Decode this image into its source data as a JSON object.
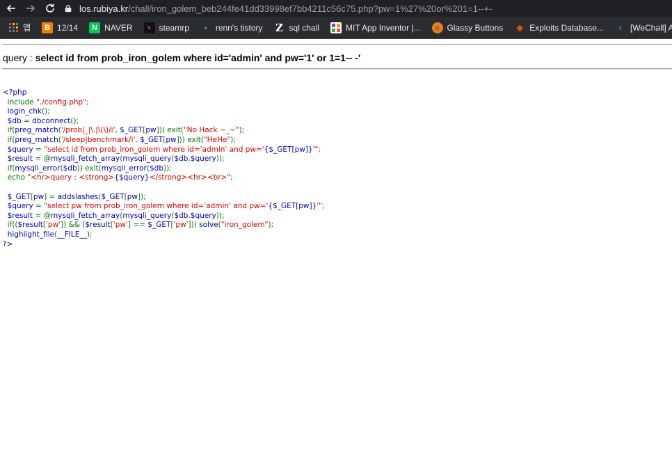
{
  "browser": {
    "url_host": "los.rubiya.kr",
    "url_path": "/chall/iron_golem_beb244fe41dd33998ef7bb4211c56c75.php?pw=1%27%20or%201=1--+-",
    "bookmarks": [
      {
        "label": "앱",
        "icon": "apps-grid-icon"
      },
      {
        "label": "12/14",
        "icon": "blogger-icon",
        "color": "#f57d00"
      },
      {
        "label": "NAVER",
        "icon": "naver-icon",
        "color": "#03c75a"
      },
      {
        "label": "steamrp",
        "icon": "steamrp-icon",
        "color": "#c0392b"
      },
      {
        "label": "renn's tistory",
        "icon": "tistory-icon",
        "color": "#4a90e2"
      },
      {
        "label": "sql chall",
        "icon": "z-icon",
        "color": "#ffffff"
      },
      {
        "label": "MIT App Inventor |...",
        "icon": "mit-app-inventor-icon",
        "color": "#8e44ad"
      },
      {
        "label": "Glassy Buttons",
        "icon": "glassy-buttons-icon",
        "color": "#e67e22"
      },
      {
        "label": "Exploits Database...",
        "icon": "exploit-db-icon",
        "color": "#d35400"
      },
      {
        "label": "[WeChall] About...",
        "icon": "wechall-icon",
        "color": "#3b6fd6"
      }
    ]
  },
  "page": {
    "query_prefix": "query : ",
    "query_text": "select id from prob_iron_golem where id='admin' and pw='1' or 1=1-- -'"
  },
  "code_lines": [
    [
      {
        "t": "<?php",
        "c": "def"
      }
    ],
    [
      {
        "t": "  include ",
        "c": "kw"
      },
      {
        "t": "\"./config.php\"",
        "c": "str"
      },
      {
        "t": ";",
        "c": "kw"
      }
    ],
    [
      {
        "t": "  login_chk",
        "c": "def"
      },
      {
        "t": "();",
        "c": "kw"
      }
    ],
    [
      {
        "t": "  $db ",
        "c": "def"
      },
      {
        "t": "= ",
        "c": "kw"
      },
      {
        "t": "dbconnect",
        "c": "def"
      },
      {
        "t": "();",
        "c": "kw"
      }
    ],
    [
      {
        "t": "  if(",
        "c": "kw"
      },
      {
        "t": "preg_match",
        "c": "def"
      },
      {
        "t": "(",
        "c": "kw"
      },
      {
        "t": "'/prob|_|\\.|\\(\\)/i'",
        "c": "str"
      },
      {
        "t": ", ",
        "c": "kw"
      },
      {
        "t": "$_GET",
        "c": "def"
      },
      {
        "t": "[",
        "c": "kw"
      },
      {
        "t": "pw",
        "c": "def"
      },
      {
        "t": "])) exit(",
        "c": "kw"
      },
      {
        "t": "\"No Hack ~_~\"",
        "c": "str"
      },
      {
        "t": ");",
        "c": "kw"
      }
    ],
    [
      {
        "t": "  if(",
        "c": "kw"
      },
      {
        "t": "preg_match",
        "c": "def"
      },
      {
        "t": "(",
        "c": "kw"
      },
      {
        "t": "'/sleep|benchmark/i'",
        "c": "str"
      },
      {
        "t": ", ",
        "c": "kw"
      },
      {
        "t": "$_GET",
        "c": "def"
      },
      {
        "t": "[",
        "c": "kw"
      },
      {
        "t": "pw",
        "c": "def"
      },
      {
        "t": "])) exit(",
        "c": "kw"
      },
      {
        "t": "\"HeHe\"",
        "c": "str"
      },
      {
        "t": ");",
        "c": "kw"
      }
    ],
    [
      {
        "t": "  $query ",
        "c": "def"
      },
      {
        "t": "= ",
        "c": "kw"
      },
      {
        "t": "\"select id from prob_iron_golem where id='admin' and pw='",
        "c": "str"
      },
      {
        "t": "{$_GET[pw]}",
        "c": "def"
      },
      {
        "t": "'\"",
        "c": "str"
      },
      {
        "t": ";",
        "c": "kw"
      }
    ],
    [
      {
        "t": "  $result ",
        "c": "def"
      },
      {
        "t": "= @",
        "c": "kw"
      },
      {
        "t": "mysqli_fetch_array",
        "c": "def"
      },
      {
        "t": "(",
        "c": "kw"
      },
      {
        "t": "mysqli_query",
        "c": "def"
      },
      {
        "t": "(",
        "c": "kw"
      },
      {
        "t": "$db",
        "c": "def"
      },
      {
        "t": ",",
        "c": "kw"
      },
      {
        "t": "$query",
        "c": "def"
      },
      {
        "t": "));",
        "c": "kw"
      }
    ],
    [
      {
        "t": "  if(",
        "c": "kw"
      },
      {
        "t": "mysqli_error",
        "c": "def"
      },
      {
        "t": "(",
        "c": "kw"
      },
      {
        "t": "$db",
        "c": "def"
      },
      {
        "t": ")) exit(",
        "c": "kw"
      },
      {
        "t": "mysqli_error",
        "c": "def"
      },
      {
        "t": "(",
        "c": "kw"
      },
      {
        "t": "$db",
        "c": "def"
      },
      {
        "t": "));",
        "c": "kw"
      }
    ],
    [
      {
        "t": "  echo ",
        "c": "kw"
      },
      {
        "t": "\"<hr>query : <strong>",
        "c": "str"
      },
      {
        "t": "{$query}",
        "c": "def"
      },
      {
        "t": "</strong><hr><br>\"",
        "c": "str"
      },
      {
        "t": ";",
        "c": "kw"
      }
    ],
    [
      {
        "t": "",
        "c": "def"
      }
    ],
    [
      {
        "t": "  $_GET",
        "c": "def"
      },
      {
        "t": "[",
        "c": "kw"
      },
      {
        "t": "pw",
        "c": "def"
      },
      {
        "t": "] = ",
        "c": "kw"
      },
      {
        "t": "addslashes",
        "c": "def"
      },
      {
        "t": "(",
        "c": "kw"
      },
      {
        "t": "$_GET",
        "c": "def"
      },
      {
        "t": "[",
        "c": "kw"
      },
      {
        "t": "pw",
        "c": "def"
      },
      {
        "t": "]);",
        "c": "kw"
      }
    ],
    [
      {
        "t": "  $query ",
        "c": "def"
      },
      {
        "t": "= ",
        "c": "kw"
      },
      {
        "t": "\"select pw from prob_iron_golem where id='admin' and pw='",
        "c": "str"
      },
      {
        "t": "{$_GET[pw]}",
        "c": "def"
      },
      {
        "t": "'\"",
        "c": "str"
      },
      {
        "t": ";",
        "c": "kw"
      }
    ],
    [
      {
        "t": "  $result ",
        "c": "def"
      },
      {
        "t": "= @",
        "c": "kw"
      },
      {
        "t": "mysqli_fetch_array",
        "c": "def"
      },
      {
        "t": "(",
        "c": "kw"
      },
      {
        "t": "mysqli_query",
        "c": "def"
      },
      {
        "t": "(",
        "c": "kw"
      },
      {
        "t": "$db",
        "c": "def"
      },
      {
        "t": ",",
        "c": "kw"
      },
      {
        "t": "$query",
        "c": "def"
      },
      {
        "t": "));",
        "c": "kw"
      }
    ],
    [
      {
        "t": "  if((",
        "c": "kw"
      },
      {
        "t": "$result",
        "c": "def"
      },
      {
        "t": "[",
        "c": "kw"
      },
      {
        "t": "'pw'",
        "c": "str"
      },
      {
        "t": "]) && (",
        "c": "kw"
      },
      {
        "t": "$result",
        "c": "def"
      },
      {
        "t": "[",
        "c": "kw"
      },
      {
        "t": "'pw'",
        "c": "str"
      },
      {
        "t": "] == ",
        "c": "kw"
      },
      {
        "t": "$_GET",
        "c": "def"
      },
      {
        "t": "[",
        "c": "kw"
      },
      {
        "t": "'pw'",
        "c": "str"
      },
      {
        "t": "])) ",
        "c": "kw"
      },
      {
        "t": "solve",
        "c": "def"
      },
      {
        "t": "(",
        "c": "kw"
      },
      {
        "t": "\"iron_golem\"",
        "c": "str"
      },
      {
        "t": ");",
        "c": "kw"
      }
    ],
    [
      {
        "t": "  highlight_file",
        "c": "def"
      },
      {
        "t": "(",
        "c": "kw"
      },
      {
        "t": "__FILE__",
        "c": "def"
      },
      {
        "t": ");",
        "c": "kw"
      }
    ],
    [
      {
        "t": "?>",
        "c": "def"
      }
    ]
  ]
}
